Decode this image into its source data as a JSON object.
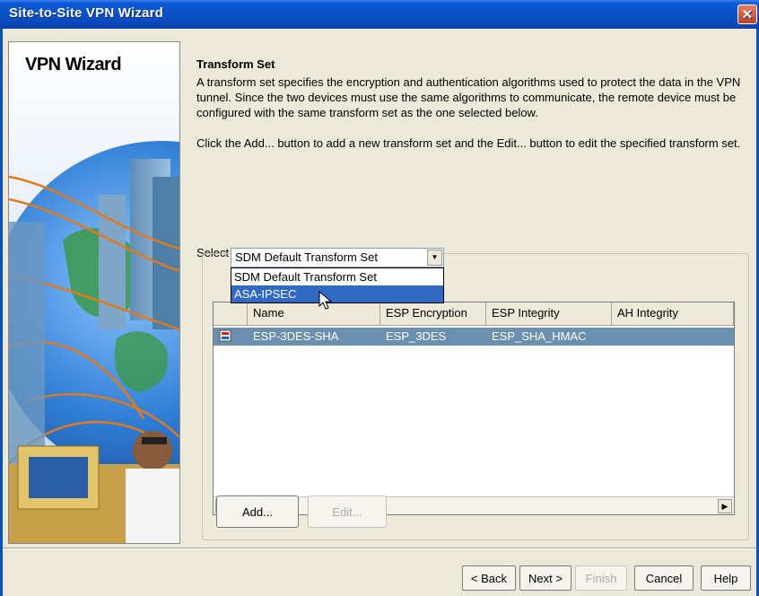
{
  "window": {
    "title": "Site-to-Site VPN Wizard",
    "close_icon": "close-icon"
  },
  "banner": {
    "title": "VPN Wizard"
  },
  "content": {
    "section_title": "Transform Set",
    "description": "A transform set specifies the encryption and authentication algorithms used to protect the data in the VPN tunnel. Since the two devices must use the same algorithms to communicate, the remote device must be configured with the same transform set as the one selected below.",
    "instructions": "Click the Add... button to add a new transform set and the Edit... button to edit the specified transform set.",
    "select_label": "Select Transform Set:"
  },
  "combo": {
    "selected": "SDM Default Transform Set",
    "options": [
      "SDM Default Transform Set",
      "ASA-IPSEC"
    ],
    "highlighted_index": 1
  },
  "details_label": "De",
  "table": {
    "columns": [
      "Name",
      "ESP Encryption",
      "ESP Integrity",
      "AH Integrity"
    ],
    "rows": [
      {
        "icon": "transform-set-icon",
        "name": "ESP-3DES-SHA",
        "esp_encryption": "ESP_3DES",
        "esp_integrity": "ESP_SHA_HMAC",
        "ah_integrity": ""
      }
    ]
  },
  "buttons": {
    "add": "Add...",
    "edit": "Edit..."
  },
  "nav": {
    "back": "< Back",
    "next": "Next >",
    "finish": "Finish",
    "cancel": "Cancel",
    "help": "Help"
  },
  "colors": {
    "titlebar": "#0b52c9",
    "selection": "#316ac5",
    "row_selected": "#6b8faf"
  }
}
